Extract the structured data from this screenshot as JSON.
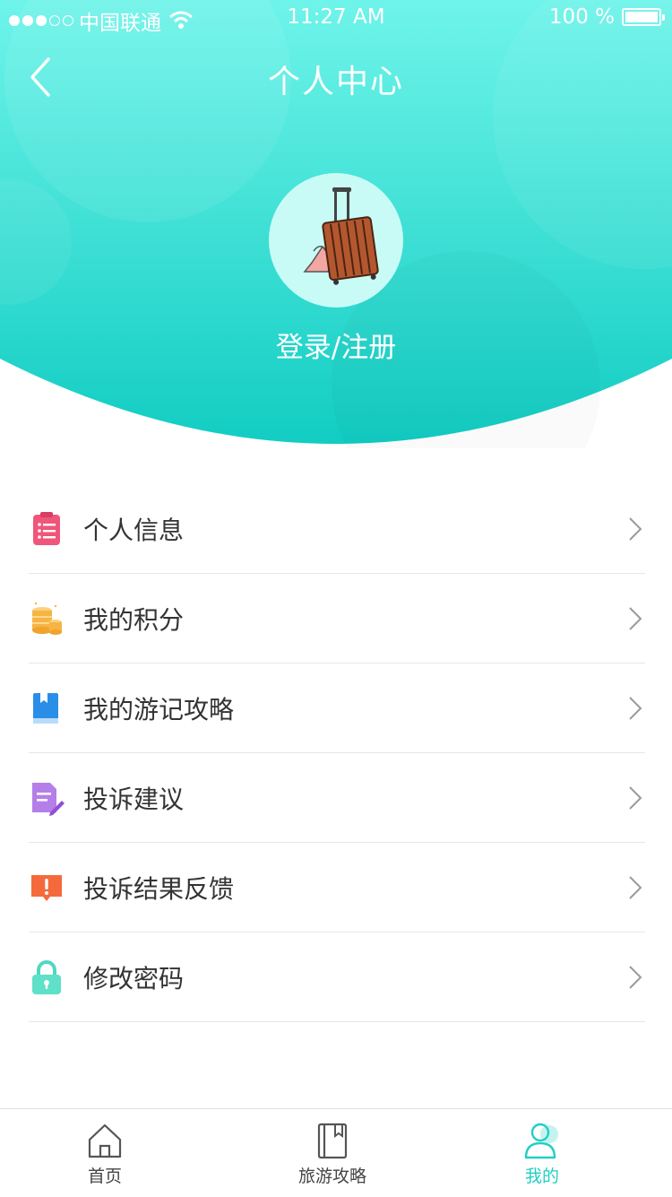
{
  "status_bar": {
    "carrier": "中国联通",
    "time": "11:27 AM",
    "battery": "100 %"
  },
  "header": {
    "title": "个人中心",
    "login_label": "登录/注册",
    "accent": "#2ed8cc"
  },
  "menu": [
    {
      "label": "个人信息",
      "icon": "clipboard-icon",
      "color": "#f0567a"
    },
    {
      "label": "我的积分",
      "icon": "coins-icon",
      "color": "#f6b445"
    },
    {
      "label": "我的游记攻略",
      "icon": "book-icon",
      "color": "#2a8ee8"
    },
    {
      "label": "投诉建议",
      "icon": "edit-document-icon",
      "color": "#b57ee8"
    },
    {
      "label": "投诉结果反馈",
      "icon": "alert-message-icon",
      "color": "#f46a3c"
    },
    {
      "label": "修改密码",
      "icon": "lock-icon",
      "color": "#4fd8c2"
    }
  ],
  "tabs": [
    {
      "label": "首页",
      "icon": "home-icon"
    },
    {
      "label": "旅游攻略",
      "icon": "guide-book-icon"
    },
    {
      "label": "我的",
      "icon": "user-icon",
      "active": true
    }
  ]
}
